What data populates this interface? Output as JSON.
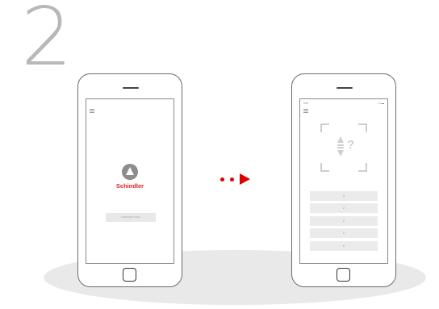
{
  "step": {
    "number": "2"
  },
  "left_phone": {
    "logo_text": "Schindler",
    "intro_button_label": "INTRODUCTION"
  },
  "right_phone": {
    "status_time": "9:41",
    "status_icons": "…≡ ▬",
    "scan_hint": "?",
    "floor_buttons": [
      "3",
      "2",
      "2",
      "1",
      "0"
    ]
  },
  "colors": {
    "accent": "#dc0000",
    "brand_red": "#d8232a"
  },
  "icons": [
    "menu-icon",
    "schindler-logo-icon",
    "updown-arrows-icon",
    "question-icon",
    "next-arrow-icon"
  ]
}
